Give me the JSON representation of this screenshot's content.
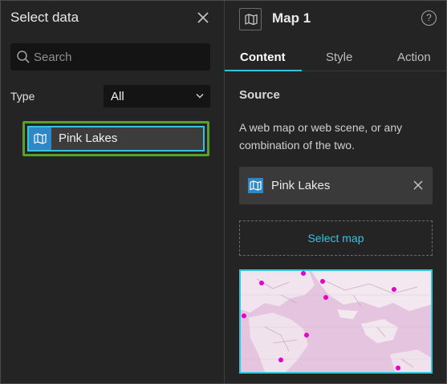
{
  "left_panel": {
    "title": "Select data",
    "search": {
      "placeholder": "Search",
      "value": ""
    },
    "type_filter": {
      "label": "Type",
      "selected": "All"
    },
    "items": [
      {
        "label": "Pink Lakes",
        "icon": "map-icon",
        "selected": true
      }
    ]
  },
  "right_panel": {
    "title": "Map 1",
    "tabs": [
      {
        "label": "Content",
        "active": true
      },
      {
        "label": "Style",
        "active": false
      },
      {
        "label": "Action",
        "active": false
      }
    ],
    "source": {
      "heading": "Source",
      "description": "A web map or web scene, or any combination of the two.",
      "selected_source": "Pink Lakes",
      "select_button": "Select map"
    }
  },
  "colors": {
    "accent": "#35c4dc",
    "selection_outline": "#5a9e2e",
    "map_icon_bg": "#2f87c6",
    "panel_bg": "#242424",
    "thumbnail_points": "#e600c8"
  }
}
